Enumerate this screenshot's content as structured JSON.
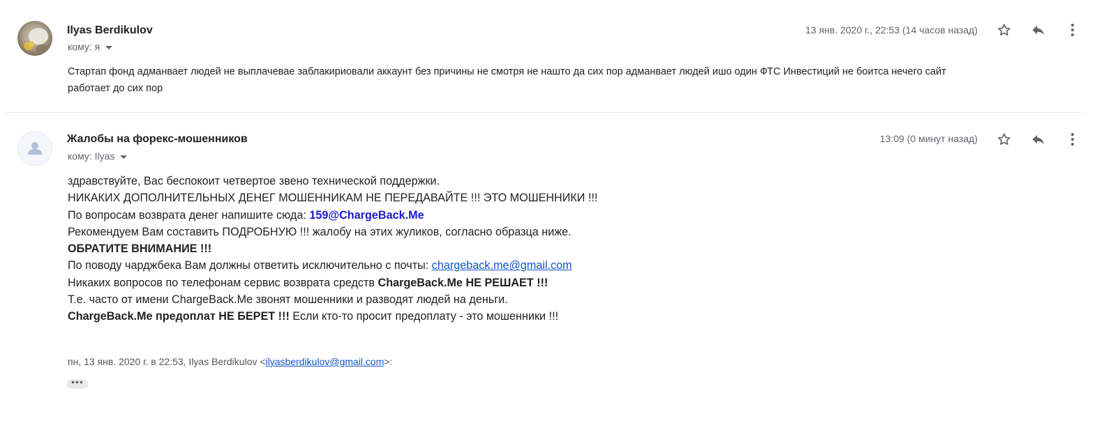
{
  "messages": [
    {
      "sender": "Ilyas Berdikulov",
      "to_label": "кому: я",
      "date": "13 янв. 2020 г., 22:53 (14 часов назад)",
      "body_lines": [
        "Стартап фонд  адманвает людей не выплачевае заблакириовали аккаунт без причины не смотря не нашто да сих пор адманвает людей ишо один ФТС Инвестиций не боитса нечего сайт",
        "работает до сих пор"
      ]
    },
    {
      "sender": "Жалобы на форекс-мошенников",
      "to_label": "кому: Ilyas",
      "date": "13:09 (0 минут назад)",
      "line1": "здравствуйте, Вас беспокоит четвертое звено технической поддержки.",
      "line2": "НИКАКИХ ДОПОЛНИТЕЛЬНЫХ ДЕНЕГ МОШЕННИКАМ НЕ ПЕРЕДАВАЙТЕ !!! ЭТО МОШЕННИКИ !!!",
      "line3_text": "По вопросам возврата денег напишите сюда: ",
      "line3_link": "159@ChargeBack.Me",
      "line4": "Рекомендуем Вам составить ПОДРОБНУЮ !!! жалобу на этих жуликов, согласно образца ниже.",
      "line5": "ОБРАТИТЕ ВНИМАНИЕ !!!",
      "line6_text": "По поводу чарджбека Вам должны ответить исключительно с почты: ",
      "line6_link": "chargeback.me@gmail.com",
      "line7_text": "Никаких вопросов по телефонам сервис возврата средств ",
      "line7_bold": "ChargeBack.Me НЕ РЕШАЕТ !!!",
      "line8": "Т.е. часто от имени ChargeBack.Me звонят мошенники и разводят людей на деньги.",
      "line9_bold": "ChargeBack.Me предоплат НЕ БЕРЕТ !!!",
      "line9_text": " Если кто-то просит предоплату - это мошенники !!!",
      "quote_prefix": "пн, 13 янв. 2020 г. в 22:53, Ilyas Berdikulov <",
      "quote_email": "ilyasberdikulov@gmail.com",
      "quote_suffix": ">:",
      "ellipsis": "•••"
    }
  ],
  "icons": [
    "star-icon",
    "reply-icon",
    "more-vert-icon"
  ]
}
